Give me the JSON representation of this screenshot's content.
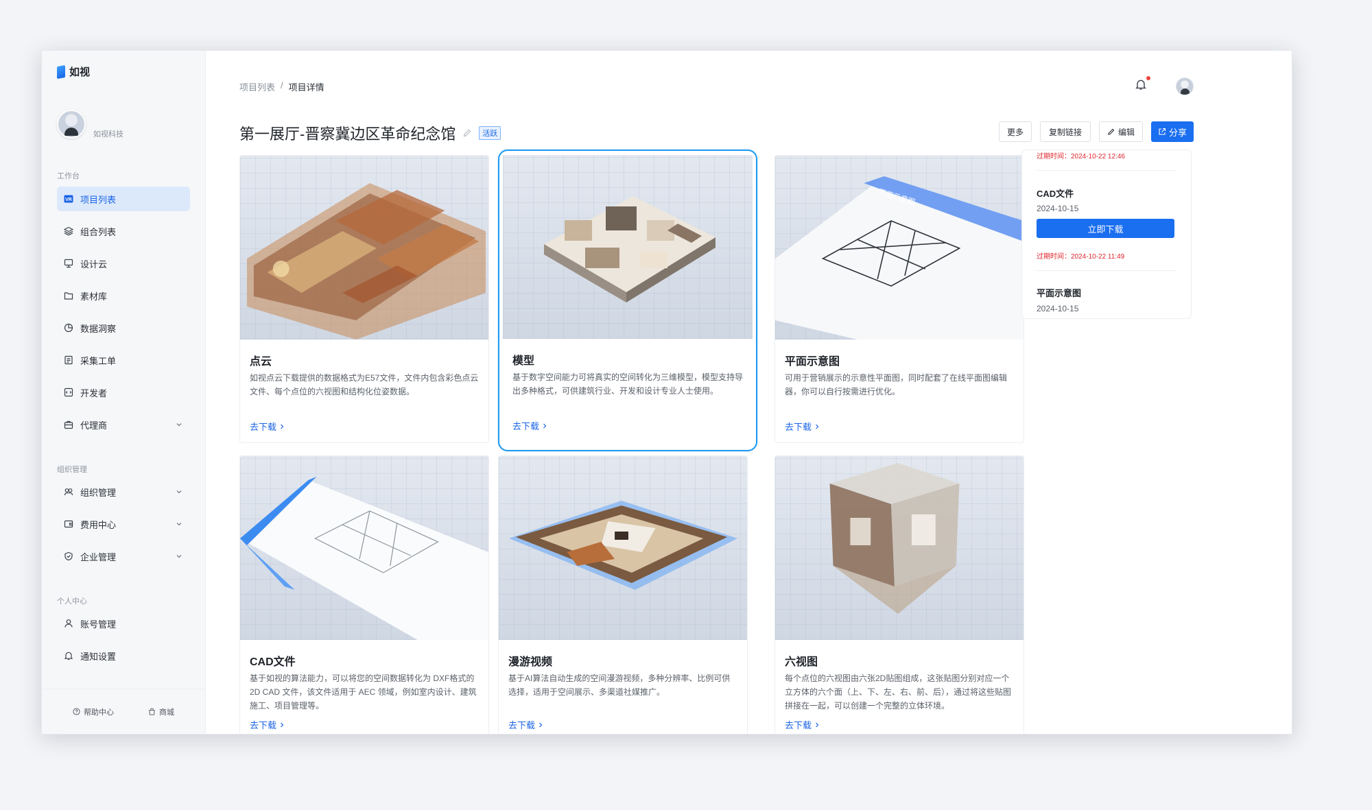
{
  "app": {
    "logo_text": "如视"
  },
  "user": {
    "org_name": "如视科技"
  },
  "sidebar": {
    "section_workspace": "工作台",
    "section_org": "组织管理",
    "section_personal": "个人中心",
    "items": [
      {
        "label": "项目列表",
        "icon": "project-list-icon",
        "active": true
      },
      {
        "label": "组合列表",
        "icon": "layers-icon"
      },
      {
        "label": "设计云",
        "icon": "monitor-icon"
      },
      {
        "label": "素材库",
        "icon": "folder-icon"
      },
      {
        "label": "数据洞察",
        "icon": "pie-chart-icon"
      },
      {
        "label": "采集工单",
        "icon": "document-icon"
      },
      {
        "label": "开发者",
        "icon": "code-icon"
      },
      {
        "label": "代理商",
        "icon": "briefcase-icon",
        "expandable": true
      },
      {
        "label": "组织管理",
        "icon": "org-icon",
        "expandable": true
      },
      {
        "label": "费用中心",
        "icon": "wallet-icon",
        "expandable": true
      },
      {
        "label": "企业管理",
        "icon": "shield-icon",
        "expandable": true
      },
      {
        "label": "账号管理",
        "icon": "user-icon"
      },
      {
        "label": "通知设置",
        "icon": "bell-icon"
      }
    ],
    "help": "帮助中心",
    "store": "商城"
  },
  "breadcrumb": {
    "parent": "项目列表",
    "separator": "/",
    "current": "项目详情"
  },
  "project": {
    "title": "第一展厅-晋察冀边区革命纪念馆",
    "status": "活跃"
  },
  "actions": {
    "more": "更多",
    "copy_link": "复制链接",
    "edit": "编辑",
    "share": "分享"
  },
  "cards": [
    {
      "title": "点云",
      "desc": "如视点云下载提供的数据格式为E57文件，文件内包含彩色点云文件、每个点位的六视图和结构化位姿数据。",
      "link": "去下载"
    },
    {
      "title": "模型",
      "desc": "基于数字空间能力可将真实的空间转化为三维模型，模型支持导出多种格式，可供建筑行业、开发和设计专业人士使用。",
      "link": "去下载"
    },
    {
      "title": "平面示意图",
      "desc": "可用于营销展示的示意性平面图，同时配套了在线平面图编辑器，你可以自行按需进行优化。",
      "link": "去下载"
    },
    {
      "title": "CAD文件",
      "desc": "基于如视的算法能力，可以将您的空间数据转化为 DXF格式的 2D CAD 文件，该文件适用于 AEC 领域，例如室内设计、建筑施工、项目管理等。",
      "link": "去下载"
    },
    {
      "title": "漫游视频",
      "desc": "基于AI算法自动生成的空间漫游视频，多种分辨率、比例可供选择，适用于空间展示、多渠道社媒推广。",
      "link": "去下载"
    },
    {
      "title": "六视图",
      "desc": "每个点位的六视图由六张2D贴图组成，这张贴图分别对应一个立方体的六个面（上、下、左、右、前、后），通过将这些贴图拼接在一起，可以创建一个完整的立体环境。",
      "link": "去下载"
    }
  ],
  "panel": {
    "top_expire": "过期时间：2024-10-22 12:46",
    "file1_name": "CAD文件",
    "file1_date": "2024-10-15",
    "download_label": "立即下载",
    "file1_expire": "过期时间：2024-10-22 11:49",
    "file2_name": "平面示意图",
    "file2_date": "2024-10-15",
    "plan_banner": "平面示意图"
  },
  "colors": {
    "primary": "#1a6ef0",
    "danger": "#e0262e",
    "highlight": "#1f9bf2"
  }
}
